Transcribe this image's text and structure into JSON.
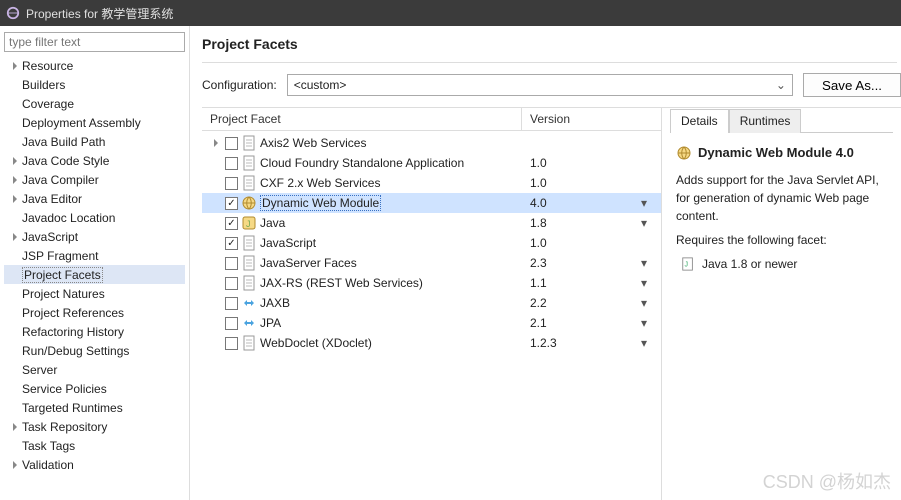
{
  "window": {
    "title": "Properties for 教学管理系统"
  },
  "sidebar": {
    "filter_placeholder": "type filter text",
    "items": [
      {
        "label": "Resource",
        "expandable": true,
        "indent": 0
      },
      {
        "label": "Builders",
        "expandable": false,
        "indent": 0
      },
      {
        "label": "Coverage",
        "expandable": false,
        "indent": 0
      },
      {
        "label": "Deployment Assembly",
        "expandable": false,
        "indent": 0
      },
      {
        "label": "Java Build Path",
        "expandable": false,
        "indent": 0
      },
      {
        "label": "Java Code Style",
        "expandable": true,
        "indent": 0
      },
      {
        "label": "Java Compiler",
        "expandable": true,
        "indent": 0
      },
      {
        "label": "Java Editor",
        "expandable": true,
        "indent": 0
      },
      {
        "label": "Javadoc Location",
        "expandable": false,
        "indent": 0
      },
      {
        "label": "JavaScript",
        "expandable": true,
        "indent": 0
      },
      {
        "label": "JSP Fragment",
        "expandable": false,
        "indent": 0
      },
      {
        "label": "Project Facets",
        "expandable": false,
        "indent": 0,
        "selected": true
      },
      {
        "label": "Project Natures",
        "expandable": false,
        "indent": 0
      },
      {
        "label": "Project References",
        "expandable": false,
        "indent": 0
      },
      {
        "label": "Refactoring History",
        "expandable": false,
        "indent": 0
      },
      {
        "label": "Run/Debug Settings",
        "expandable": false,
        "indent": 0
      },
      {
        "label": "Server",
        "expandable": false,
        "indent": 0
      },
      {
        "label": "Service Policies",
        "expandable": false,
        "indent": 0
      },
      {
        "label": "Targeted Runtimes",
        "expandable": false,
        "indent": 0
      },
      {
        "label": "Task Repository",
        "expandable": true,
        "indent": 0
      },
      {
        "label": "Task Tags",
        "expandable": false,
        "indent": 0
      },
      {
        "label": "Validation",
        "expandable": true,
        "indent": 0
      }
    ]
  },
  "heading": "Project Facets",
  "config": {
    "label": "Configuration:",
    "value": "<custom>",
    "saveAs": "Save As..."
  },
  "columns": {
    "facet": "Project Facet",
    "version": "Version"
  },
  "facets": [
    {
      "label": "Axis2 Web Services",
      "checked": false,
      "expandable": true,
      "version": "",
      "dropdown": false,
      "icon": "doc"
    },
    {
      "label": "Cloud Foundry Standalone Application",
      "checked": false,
      "expandable": false,
      "version": "1.0",
      "dropdown": false,
      "icon": "doc"
    },
    {
      "label": "CXF 2.x Web Services",
      "checked": false,
      "expandable": false,
      "version": "1.0",
      "dropdown": false,
      "icon": "doc"
    },
    {
      "label": "Dynamic Web Module",
      "checked": true,
      "expandable": false,
      "version": "4.0",
      "dropdown": true,
      "icon": "globe",
      "selected": true
    },
    {
      "label": "Java",
      "checked": true,
      "expandable": false,
      "version": "1.8",
      "dropdown": true,
      "icon": "java"
    },
    {
      "label": "JavaScript",
      "checked": true,
      "expandable": false,
      "version": "1.0",
      "dropdown": false,
      "icon": "doc"
    },
    {
      "label": "JavaServer Faces",
      "checked": false,
      "expandable": false,
      "version": "2.3",
      "dropdown": true,
      "icon": "doc"
    },
    {
      "label": "JAX-RS (REST Web Services)",
      "checked": false,
      "expandable": false,
      "version": "1.1",
      "dropdown": true,
      "icon": "doc"
    },
    {
      "label": "JAXB",
      "checked": false,
      "expandable": false,
      "version": "2.2",
      "dropdown": true,
      "icon": "jaxb"
    },
    {
      "label": "JPA",
      "checked": false,
      "expandable": false,
      "version": "2.1",
      "dropdown": true,
      "icon": "jaxb"
    },
    {
      "label": "WebDoclet (XDoclet)",
      "checked": false,
      "expandable": false,
      "version": "1.2.3",
      "dropdown": true,
      "icon": "doc"
    }
  ],
  "tabs": {
    "details": "Details",
    "runtimes": "Runtimes"
  },
  "details": {
    "title": "Dynamic Web Module 4.0",
    "desc": "Adds support for the Java Servlet API, for generation of dynamic Web page content.",
    "reqLabel": "Requires the following facet:",
    "req1": "Java 1.8 or newer"
  },
  "watermark": "CSDN @杨如杰"
}
